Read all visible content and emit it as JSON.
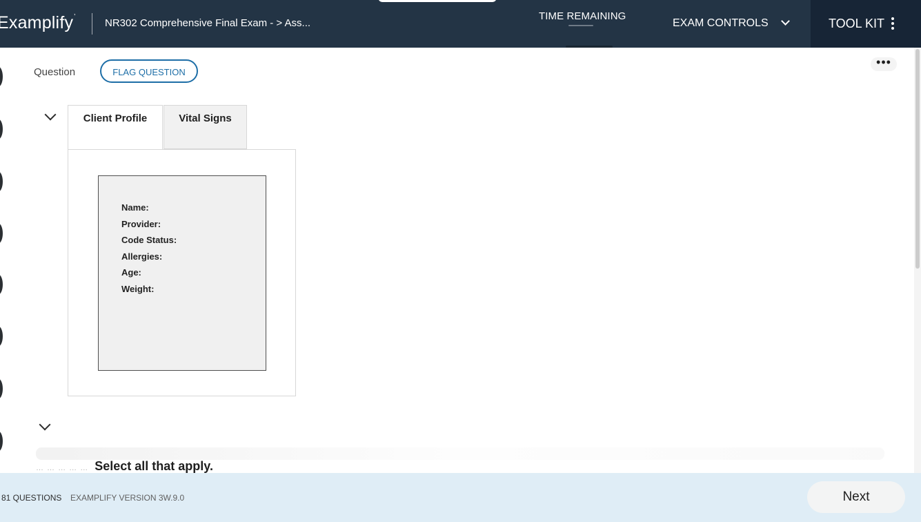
{
  "header": {
    "brand": "Examplify",
    "exam_title": "NR302 Comprehensive Final Exam - > Ass...",
    "timer_label": "TIME REMAINING",
    "exam_controls_label": "EXAM CONTROLS",
    "toolkit_label": "TOOL KIT"
  },
  "question": {
    "label": "Question",
    "flag_button": "FLAG QUESTION",
    "more_label": "•••"
  },
  "tabs": [
    {
      "label": "Client Profile"
    },
    {
      "label": "Vital Signs"
    }
  ],
  "client_profile": {
    "fields": [
      {
        "label": "Name:",
        "value": ""
      },
      {
        "label": "Provider:",
        "value": ""
      },
      {
        "label": "Code Status:",
        "value": ""
      },
      {
        "label": "Allergies:",
        "value": ""
      },
      {
        "label": "Age:",
        "value": ""
      },
      {
        "label": "Weight:",
        "value": ""
      }
    ]
  },
  "instruction": {
    "text": "Select all that apply."
  },
  "footer": {
    "question_count": "81 QUESTIONS",
    "version": "EXAMPLIFY VERSION 3W.9.0",
    "next_button": "Next"
  },
  "colors": {
    "topbar_bg": "#233445",
    "toolkit_bg": "#172536",
    "footer_bg": "#dfedf6",
    "accent_blue": "#1d6ea7"
  },
  "icons": {
    "chevron_down": "chevron-down-icon",
    "kebab": "kebab-icon",
    "more": "more-horizontal-icon"
  }
}
